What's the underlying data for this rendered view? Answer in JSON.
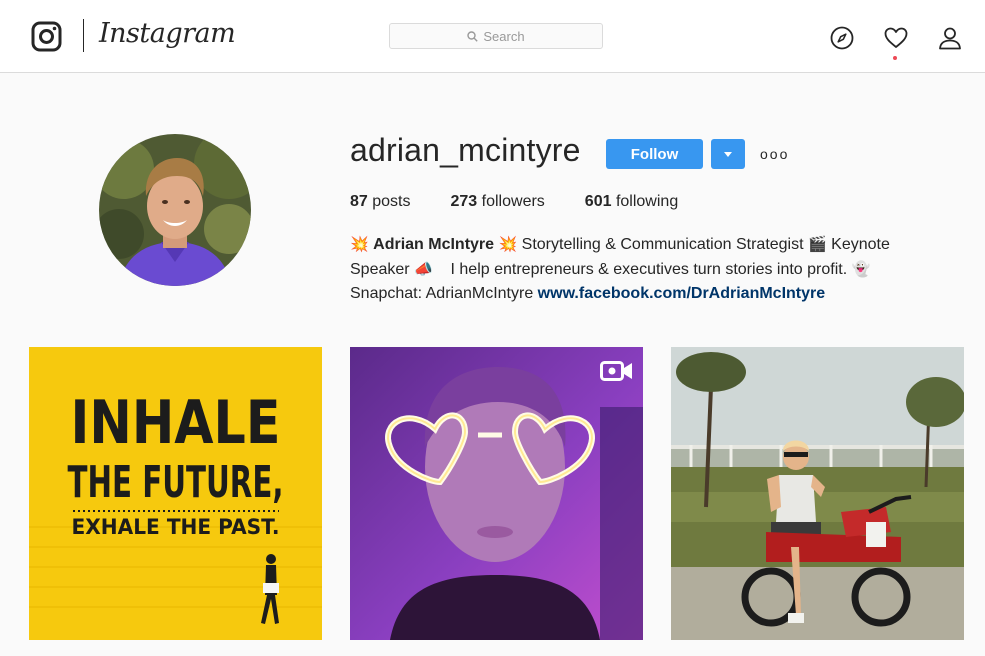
{
  "header": {
    "wordmark": "Instagram",
    "search_placeholder": "Search",
    "icons": [
      "instagram-camera-icon",
      "compass-icon",
      "heart-icon",
      "person-icon"
    ],
    "notification_dot_color": "#ed4956"
  },
  "profile": {
    "username": "adrian_mcintyre",
    "follow_label": "Follow",
    "more_label": "ooo",
    "stats": {
      "posts_count": "87",
      "posts_label": "posts",
      "followers_count": "273",
      "followers_label": "followers",
      "following_count": "601",
      "following_label": "following"
    },
    "bio": {
      "emoji_1": "💥",
      "name": "Adrian McIntyre",
      "emoji_2": "💥",
      "text_1": "Storytelling & Communication Strategist",
      "emoji_3": "🎬",
      "text_2": "Keynote Speaker",
      "emoji_4": "📣",
      "text_3": "I help entrepreneurs & executives turn stories into profit.",
      "emoji_5": "👻",
      "text_4": "Snapchat: AdrianMcIntyre",
      "link": "www.facebook.com/DrAdrianMcIntyre"
    }
  },
  "posts": [
    {
      "type": "image",
      "line_1": "INHALE",
      "line_2": "THE FUTURE,",
      "line_3": "EXHALE THE PAST."
    },
    {
      "type": "video"
    },
    {
      "type": "image"
    }
  ],
  "colors": {
    "accent": "#3897f0",
    "link": "#003569",
    "background": "#fafafa",
    "border": "#dbdbdb"
  }
}
